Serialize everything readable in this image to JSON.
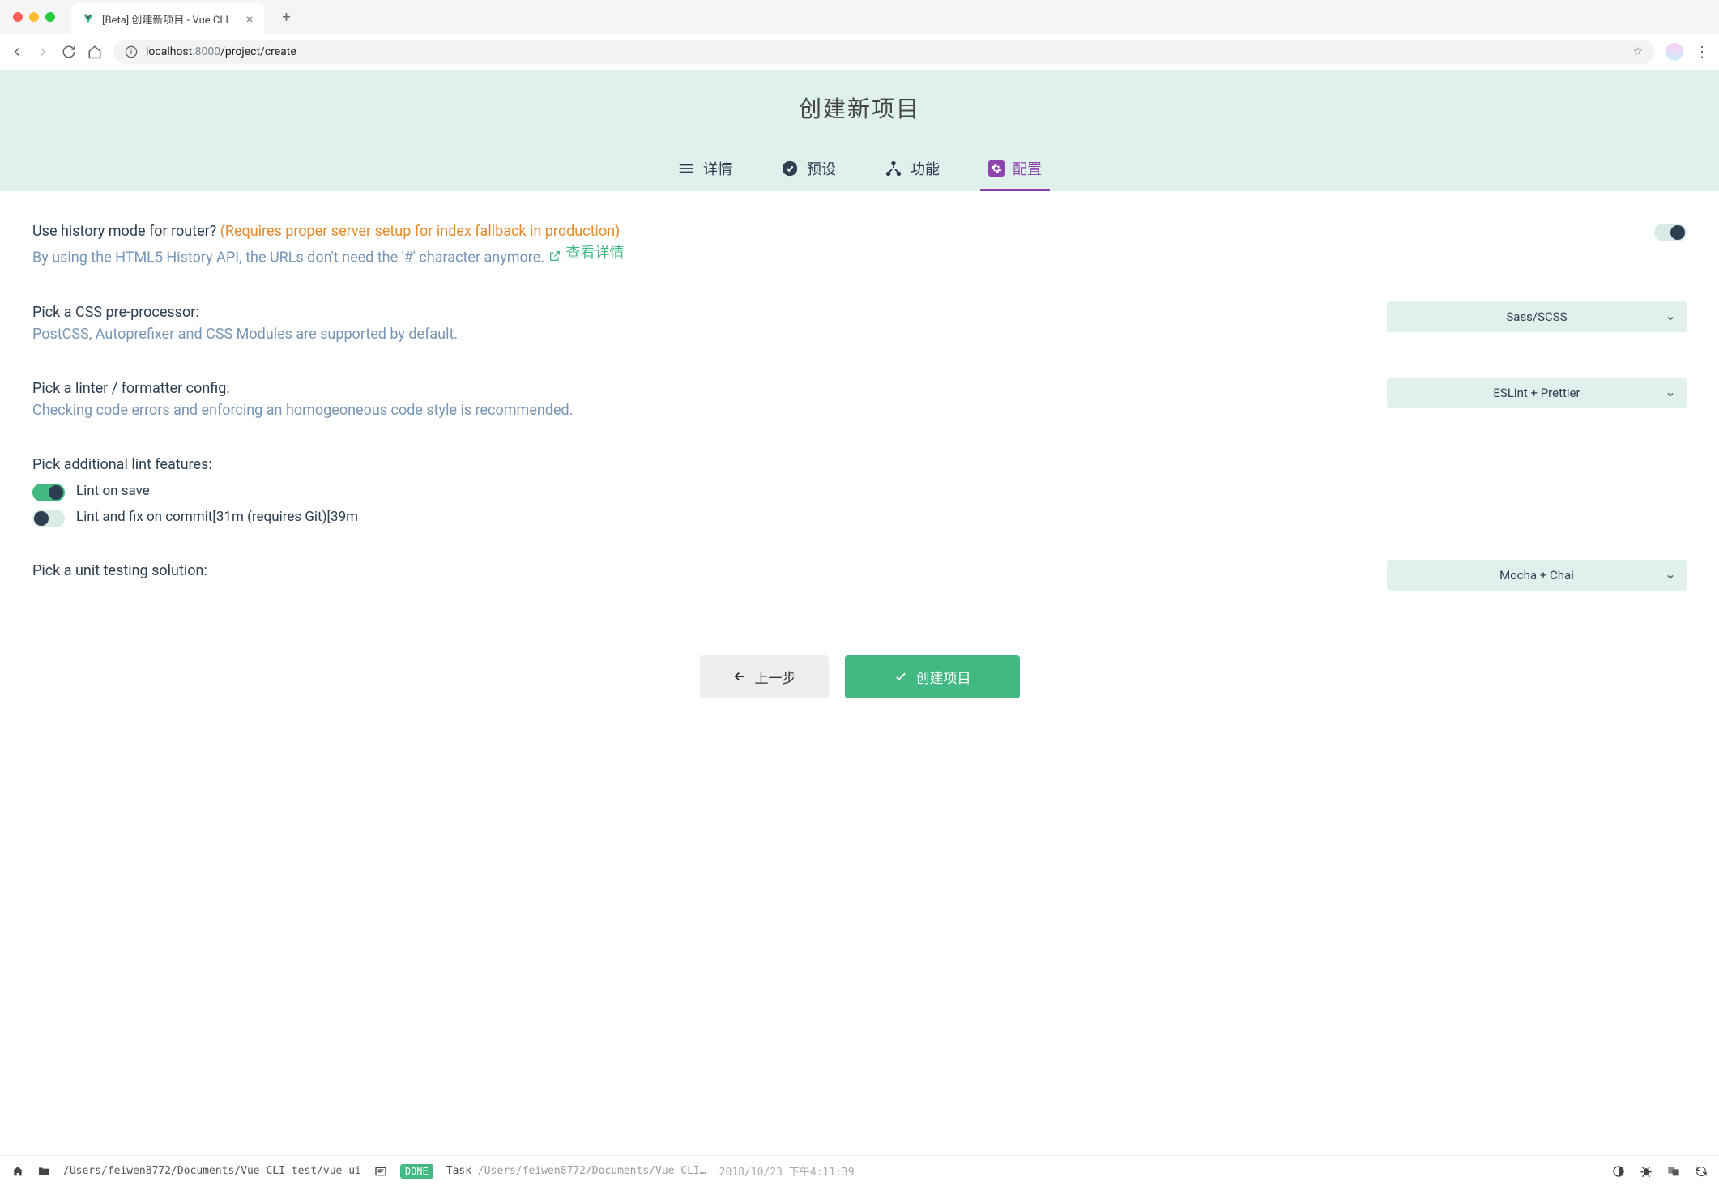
{
  "browser": {
    "tab_title": "[Beta] 创建新项目 - Vue CLI",
    "url_host": "localhost",
    "url_port": ":8000",
    "url_path": "/project/create"
  },
  "header": {
    "title": "创建新项目",
    "tabs": {
      "details": "详情",
      "preset": "预设",
      "features": "功能",
      "config": "配置"
    }
  },
  "options": {
    "router": {
      "label": "Use history mode for router?",
      "warning": "(Requires proper server setup for index fallback in production)",
      "desc": "By using the HTML5 History API, the URLs don't need the '#' character anymore.",
      "link": "查看详情",
      "enabled": true
    },
    "css": {
      "label": "Pick a CSS pre-processor:",
      "desc": "PostCSS, Autoprefixer and CSS Modules are supported by default.",
      "selected": "Sass/SCSS"
    },
    "linter": {
      "label": "Pick a linter / formatter config:",
      "desc": "Checking code errors and enforcing an homogeoneous code style is recommended.",
      "selected": "ESLint + Prettier"
    },
    "lintFeatures": {
      "label": "Pick additional lint features:",
      "lintOnSave": {
        "label": "Lint on save",
        "enabled": true
      },
      "lintOnCommit": {
        "label": "Lint and fix on commit[31m (requires Git)[39m",
        "enabled": false
      }
    },
    "unit": {
      "label": "Pick a unit testing solution:",
      "selected": "Mocha + Chai"
    }
  },
  "buttons": {
    "prev": "上一步",
    "create": "创建项目"
  },
  "statusbar": {
    "path": "/Users/feiwen8772/Documents/Vue CLI test/vue-ui",
    "badge": "DONE",
    "task_prefix": "Task",
    "task_path": "/Users/feiwen8772/Documents/Vue CLI…",
    "timestamp": "2018/10/23 下午4:11:39"
  }
}
